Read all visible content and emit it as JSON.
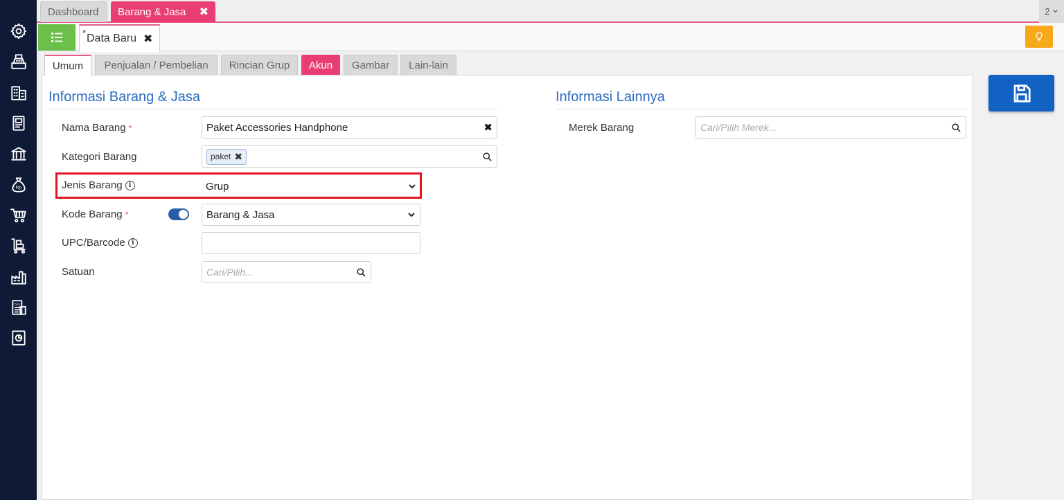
{
  "top_tabs": {
    "dashboard": "Dashboard",
    "barang_jasa": "Barang & Jasa",
    "counter": "2"
  },
  "doc_tab": {
    "modified_mark": "*",
    "label": "Data Baru"
  },
  "form_tabs": [
    "Umum",
    "Penjualan / Pembelian",
    "Rincian Grup",
    "Akun",
    "Gambar",
    "Lain-lain"
  ],
  "left_section": {
    "title": "Informasi Barang & Jasa",
    "nama_barang": {
      "label": "Nama Barang",
      "required": "*",
      "value": "Paket Accessories Handphone"
    },
    "kategori_barang": {
      "label": "Kategori Barang",
      "tag": "paket"
    },
    "jenis_barang": {
      "label": "Jenis Barang",
      "value": "Grup"
    },
    "kode_barang": {
      "label": "Kode Barang",
      "required": "*",
      "value": "Barang & Jasa",
      "toggle_on": true
    },
    "upc_barcode": {
      "label": "UPC/Barcode",
      "value": ""
    },
    "satuan": {
      "label": "Satuan",
      "placeholder": "Cari/Pilih..."
    }
  },
  "right_section": {
    "title": "Informasi Lainnya",
    "merek_barang": {
      "label": "Merek Barang",
      "placeholder": "Cari/Pilih Merek..."
    }
  },
  "colors": {
    "sidebar": "#0f1b36",
    "accent_pink": "#e83e73",
    "save_blue": "#1262c4",
    "list_green": "#6cc04a",
    "bulb_orange": "#f7a81b",
    "section_title_blue": "#2a6cc0",
    "highlight_red": "#e3141e"
  },
  "icons": {
    "sidebar": [
      "gear-icon",
      "cash-register-icon",
      "building-icon",
      "ledger-icon",
      "bank-icon",
      "money-bag-icon",
      "cart-icon",
      "trolley-icon",
      "factory-icon",
      "tax-icon",
      "report-icon"
    ],
    "toolbar": [
      "list-icon",
      "lightbulb-icon",
      "save-icon"
    ]
  }
}
